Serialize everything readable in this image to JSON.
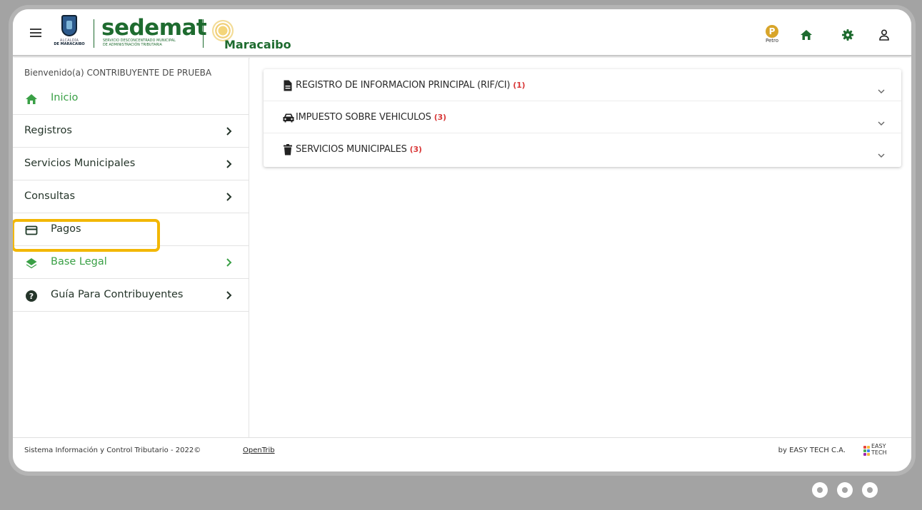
{
  "header": {
    "menu_icon": "hamburger-menu-icon",
    "crest_line1": "ALCALDÍA",
    "crest_line2": "DE MARACAIBO",
    "brand": "sedemat",
    "brand_sub_line1": "SERVICIO DESCONCENTRADO MUNICIPAL",
    "brand_sub_line2": "DE ADMINISTRACIÓN TRIBUTARIA",
    "city": "Maracaibo",
    "petro_label": "Petro",
    "icons": [
      "petro-icon",
      "home-icon",
      "gear-icon",
      "user-icon"
    ],
    "brand_color": "#1e6b2f"
  },
  "sidebar": {
    "welcome": "Bienvenido(a) CONTRIBUYENTE DE PRUEBA",
    "items": [
      {
        "label": "Inicio",
        "icon": "home-icon",
        "has_chevron": false
      },
      {
        "label": "Registros",
        "icon": "",
        "has_chevron": true
      },
      {
        "label": "Servicios Municipales",
        "icon": "",
        "has_chevron": true
      },
      {
        "label": "Consultas",
        "icon": "",
        "has_chevron": true
      },
      {
        "label": "Pagos",
        "icon": "credit-card-icon",
        "has_chevron": false,
        "highlighted": true
      },
      {
        "label": "Base Legal",
        "icon": "layers-icon",
        "has_chevron": true
      },
      {
        "label": "Guía Para Contribuyentes",
        "icon": "help-circle-icon",
        "has_chevron": true
      }
    ],
    "highlight_color": "#f2b705"
  },
  "main": {
    "sections": [
      {
        "title": "REGISTRO DE INFORMACION PRINCIPAL (RIF/CI)",
        "count": "(1)",
        "icon": "document-icon"
      },
      {
        "title": "IMPUESTO SOBRE VEHICULOS",
        "count": "(3)",
        "icon": "car-icon"
      },
      {
        "title": "SERVICIOS MUNICIPALES",
        "count": "(3)",
        "icon": "trash-icon"
      }
    ],
    "count_color": "#d93a3a"
  },
  "footer": {
    "left_text": "Sistema Información y Control Tributario - 2022©",
    "opentrib": "OpenTrib",
    "right_text": "by EASY TECH C.A.",
    "easy_line1": "EASY",
    "easy_line2": "TECH"
  }
}
